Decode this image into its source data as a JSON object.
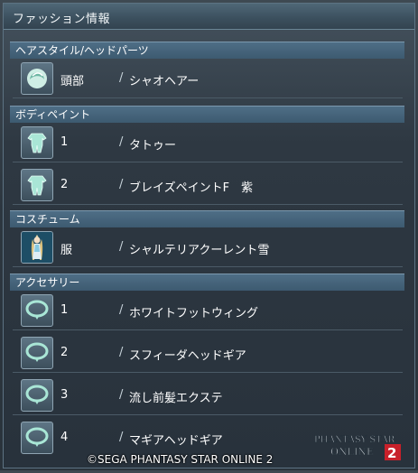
{
  "window": {
    "title": "ファッション情報"
  },
  "sections": [
    {
      "header": "ヘアスタイル/ヘッドパーツ",
      "items": [
        {
          "slot": "頭部",
          "name": "シャオヘアー",
          "icon": "hair-icon"
        }
      ]
    },
    {
      "header": "ボディペイント",
      "items": [
        {
          "slot": "1",
          "name": "タトゥー",
          "icon": "bodysuit-icon"
        },
        {
          "slot": "2",
          "name": "ブレイズペイントF　紫",
          "icon": "bodysuit-icon"
        }
      ]
    },
    {
      "header": "コスチューム",
      "items": [
        {
          "slot": "服",
          "name": "シャルテリアクーレント雪",
          "icon": "character-portrait"
        }
      ]
    },
    {
      "header": "アクセサリー",
      "items": [
        {
          "slot": "1",
          "name": "ホワイトフットウィング",
          "icon": "ring-icon"
        },
        {
          "slot": "2",
          "name": "スフィーダヘッドギア",
          "icon": "ring-icon"
        },
        {
          "slot": "3",
          "name": "流し前髪エクステ",
          "icon": "ring-icon"
        },
        {
          "slot": "4",
          "name": "マギアヘッドギア",
          "icon": "ring-icon"
        }
      ]
    }
  ],
  "separator": "/",
  "footer": {
    "copyright": "©SEGA PHANTASY STAR ONLINE 2",
    "logo_text": "PHANTASY STAR ONLINE 2"
  },
  "colors": {
    "section_header": "#4e6e86",
    "panel": "#2e3842",
    "icon_mint": "#a9e6d6"
  }
}
